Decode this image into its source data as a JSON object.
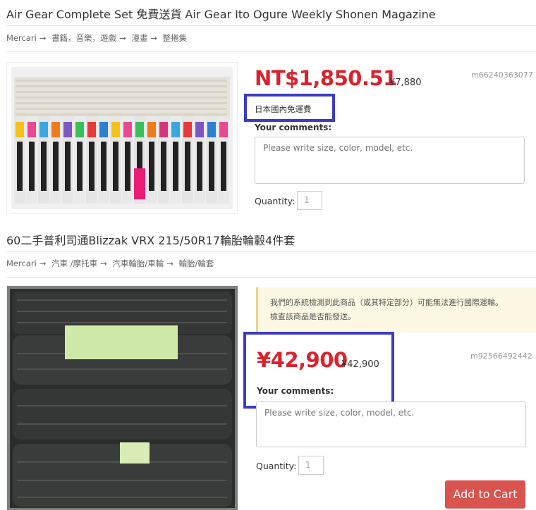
{
  "item1": {
    "title": "Air Gear Complete Set 免費送貨 Air Gear Ito Ogure Weekly Shonen Magazine",
    "breadcrumb": [
      "Mercari",
      "書籍，音樂，遊戲",
      "漫畫",
      "整捲集"
    ],
    "price": "NT$1,850.51",
    "price_sub": "¥7,880",
    "sku": "m66240363077",
    "shipping_note": "日本國內免運費",
    "comments_label": "Your comments:",
    "comments_placeholder": "Please write size, color, model, etc.",
    "quantity_label": "Quantity:",
    "quantity_value": "1",
    "image_icon": "manga-volumes-photo"
  },
  "item2": {
    "title": "60二手普利司通Blizzak VRX 215/50R17輪胎輪轂4件套",
    "breadcrumb": [
      "Mercari",
      "汽車 /摩托車",
      "汽車輪胎/車輪",
      "輪胎/輪套"
    ],
    "notice_lines": [
      "我們的系統檢測到此商品（或其特定部分）可能無法進行國際運輸。",
      "檢查該商品是否能發送。"
    ],
    "price": "¥42,900",
    "price_sub": "¥42,900",
    "sku": "m92566492442",
    "comments_label": "Your comments:",
    "comments_placeholder": "Please write size, color, model, etc.",
    "quantity_label": "Quantity:",
    "quantity_value": "1",
    "add_to_cart": "Add to Cart",
    "image_icon": "stacked-tires-photo"
  },
  "breadcrumb_separator": "→",
  "colors": {
    "price": "#d9232e",
    "highlight": "#3c3cc2",
    "cart": "#d9534f",
    "notice_bg": "#fcf8e3"
  }
}
